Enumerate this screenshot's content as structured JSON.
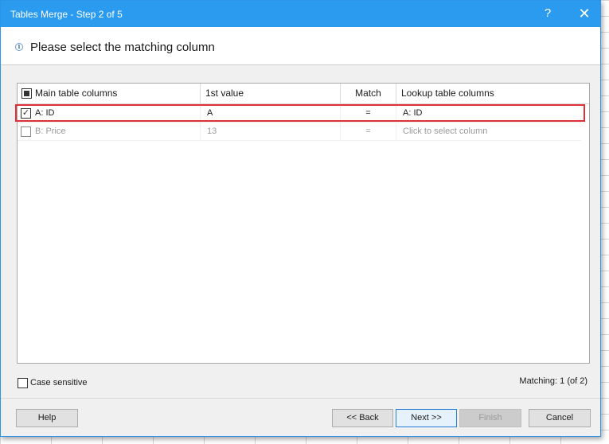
{
  "window": {
    "title": "Tables Merge - Step 2 of 5",
    "help_symbol": "?",
    "close_symbol": "✕"
  },
  "header": {
    "info_symbol": "i",
    "title": "Please select the matching column"
  },
  "grid": {
    "columns": {
      "main": "Main table columns",
      "first_value": "1st value",
      "match": "Match",
      "lookup": "Lookup table columns"
    },
    "rows": [
      {
        "checked": true,
        "check_mark": "✓",
        "main": "A: ID",
        "first_value": "A",
        "match": "=",
        "lookup": "A: ID"
      },
      {
        "checked": false,
        "check_mark": "",
        "main": "B: Price",
        "first_value": "13",
        "match": "=",
        "lookup": "Click to select column"
      }
    ]
  },
  "options": {
    "case_sensitive_label": "Case sensitive",
    "case_sensitive_checked": false,
    "matching_status": "Matching: 1 (of 2)"
  },
  "buttons": {
    "help": "Help",
    "back": "<< Back",
    "next": "Next >>",
    "finish": "Finish",
    "cancel": "Cancel"
  },
  "colors": {
    "titlebar": "#2b9bf0",
    "highlight": "#e0313b"
  }
}
